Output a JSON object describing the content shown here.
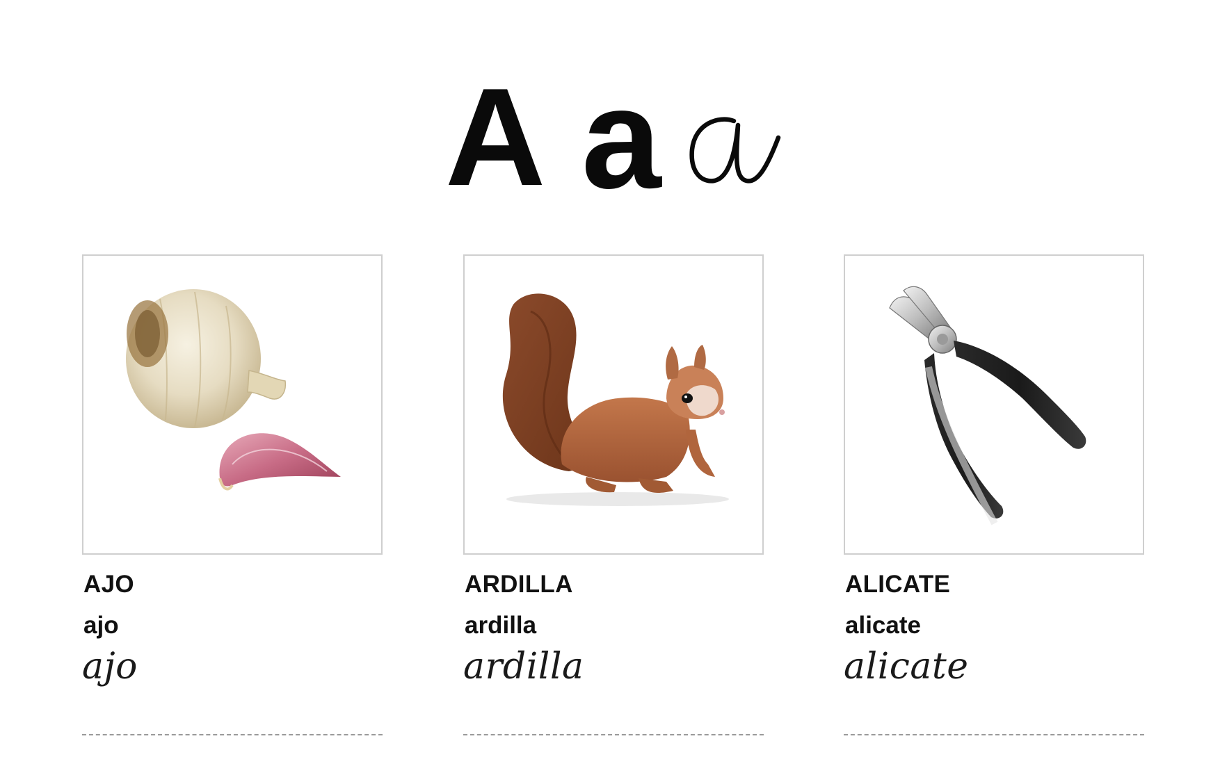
{
  "header": {
    "upper": "A",
    "lower_print": "a",
    "lower_cursive": "a"
  },
  "cards": [
    {
      "word_upper": "AJO",
      "word_lower": "ajo",
      "word_cursive": "ajo",
      "image": "garlic-photo"
    },
    {
      "word_upper": "ARDILLA",
      "word_lower": "ardilla",
      "word_cursive": "ardilla",
      "image": "squirrel-photo"
    },
    {
      "word_upper": "ALICATE",
      "word_lower": "alicate",
      "word_cursive": "alicate",
      "image": "pliers-photo"
    }
  ],
  "colors": {
    "text": "#111111",
    "frame_border": "#cfcfcf",
    "dashed_line": "#9a9a9a"
  }
}
